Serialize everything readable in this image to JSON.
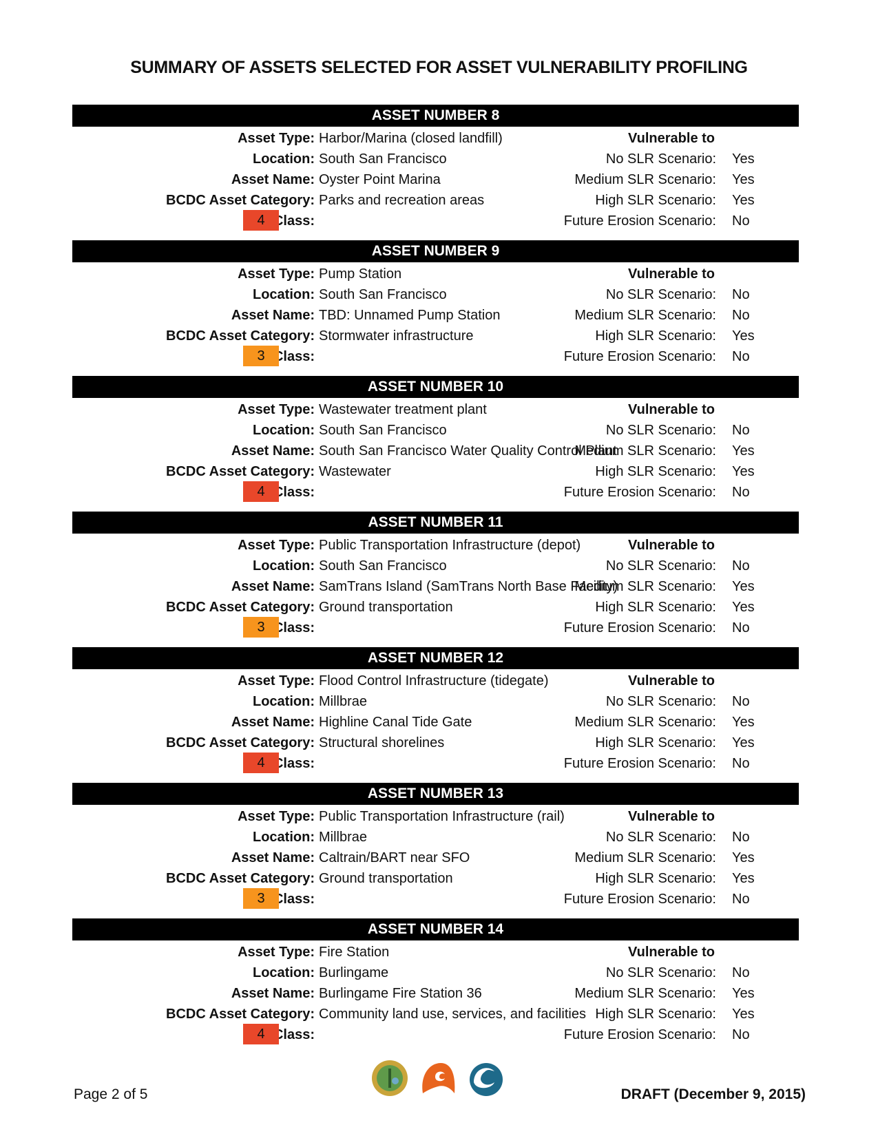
{
  "title": "SUMMARY OF  ASSETS SELECTED FOR ASSET VULNERABILITY PROFILING",
  "labels": {
    "asset_type": "Asset Type:",
    "location": "Location:",
    "asset_name": "Asset Name:",
    "bcdc_category": "BCDC Asset Category:",
    "class": "Class:",
    "vulnerable_to": "Vulnerable to",
    "no_slr": "No SLR Scenario:",
    "medium_slr": "Medium SLR Scenario:",
    "high_slr": "High SLR Scenario:",
    "future_erosion": "Future Erosion Scenario:"
  },
  "class_colors": {
    "3": "#f7941d",
    "4": "#e8472a"
  },
  "assets": [
    {
      "header": "ASSET NUMBER 8",
      "asset_type": "Harbor/Marina (closed landfill)",
      "location": "South San Francisco",
      "asset_name": "Oyster Point Marina",
      "bcdc_category": "Parks and recreation areas",
      "class": "4",
      "no_slr": "Yes",
      "medium_slr": "Yes",
      "high_slr": "Yes",
      "future_erosion": "No"
    },
    {
      "header": "ASSET NUMBER 9",
      "asset_type": "Pump Station",
      "location": "South San Francisco",
      "asset_name": "TBD: Unnamed  Pump Station",
      "bcdc_category": "Stormwater infrastructure",
      "class": "3",
      "no_slr": "No",
      "medium_slr": "No",
      "high_slr": "Yes",
      "future_erosion": "No"
    },
    {
      "header": "ASSET NUMBER 10",
      "asset_type": "Wastewater treatment plant",
      "location": "South San Francisco",
      "asset_name": "South San Francisco Water Quality Control Plant",
      "bcdc_category": "Wastewater",
      "class": "4",
      "no_slr": "No",
      "medium_slr": "Yes",
      "high_slr": "Yes",
      "future_erosion": "No"
    },
    {
      "header": "ASSET NUMBER 11",
      "asset_type": "Public Transportation Infrastructure (depot)",
      "location": "South San Francisco",
      "asset_name": "SamTrans Island (SamTrans North Base Facility)",
      "bcdc_category": "Ground transportation",
      "class": "3",
      "no_slr": "No",
      "medium_slr": "Yes",
      "high_slr": "Yes",
      "future_erosion": "No"
    },
    {
      "header": "ASSET NUMBER 12",
      "asset_type": "Flood Control Infrastructure (tidegate)",
      "location": "Millbrae",
      "asset_name": "Highline Canal Tide Gate",
      "bcdc_category": "Structural shorelines",
      "class": "4",
      "no_slr": "No",
      "medium_slr": "Yes",
      "high_slr": "Yes",
      "future_erosion": "No"
    },
    {
      "header": "ASSET NUMBER 13",
      "asset_type": "Public Transportation Infrastructure (rail)",
      "location": "Millbrae",
      "asset_name": "Caltrain/BART near SFO",
      "bcdc_category": "Ground transportation",
      "class": "3",
      "no_slr": "No",
      "medium_slr": "Yes",
      "high_slr": "Yes",
      "future_erosion": "No"
    },
    {
      "header": "ASSET NUMBER 14",
      "asset_type": "Fire Station",
      "location": "Burlingame",
      "asset_name": "Burlingame Fire Station 36",
      "bcdc_category": "Community land use, services, and facilities",
      "class": "4",
      "no_slr": "No",
      "medium_slr": "Yes",
      "high_slr": "Yes",
      "future_erosion": "No"
    }
  ],
  "footer": {
    "page": "Page 2 of 5",
    "draft": "DRAFT (December 9, 2015)",
    "logos": [
      "county-of-san-mateo-seal-icon",
      "orange-wave-logo-icon",
      "blue-wave-logo-icon"
    ]
  }
}
